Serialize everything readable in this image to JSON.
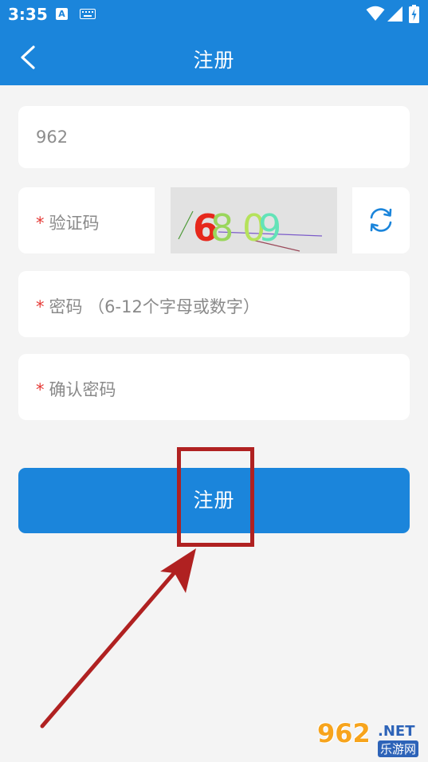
{
  "status_bar": {
    "time": "3:35",
    "notif_a": "A",
    "icons": [
      "keyboard-icon",
      "wifi-icon",
      "signal-icon",
      "battery-charging-icon"
    ]
  },
  "header": {
    "title": "注册",
    "back_icon": "chevron-left-icon"
  },
  "form": {
    "phone_value": "962",
    "required_mark": "*",
    "captcha_placeholder": "验证码",
    "captcha_text": "6809",
    "captcha_chars": [
      {
        "char": "6",
        "color": "#e6281c"
      },
      {
        "char": "8",
        "color": "#9ad65c"
      },
      {
        "char": "0",
        "color": "#b5e25b"
      },
      {
        "char": "9",
        "color": "#63e3b8"
      }
    ],
    "refresh_icon": "refresh-icon",
    "password_placeholder": "密码 （6-12个字母或数字）",
    "confirm_placeholder": "确认密码",
    "submit_label": "注册"
  },
  "colors": {
    "brand": "#1b85db",
    "background": "#f4f4f4",
    "required": "#e53935",
    "annotation": "#b02121"
  },
  "watermark": {
    "number": "962",
    "domain": ".NET",
    "cn": "乐游网"
  }
}
